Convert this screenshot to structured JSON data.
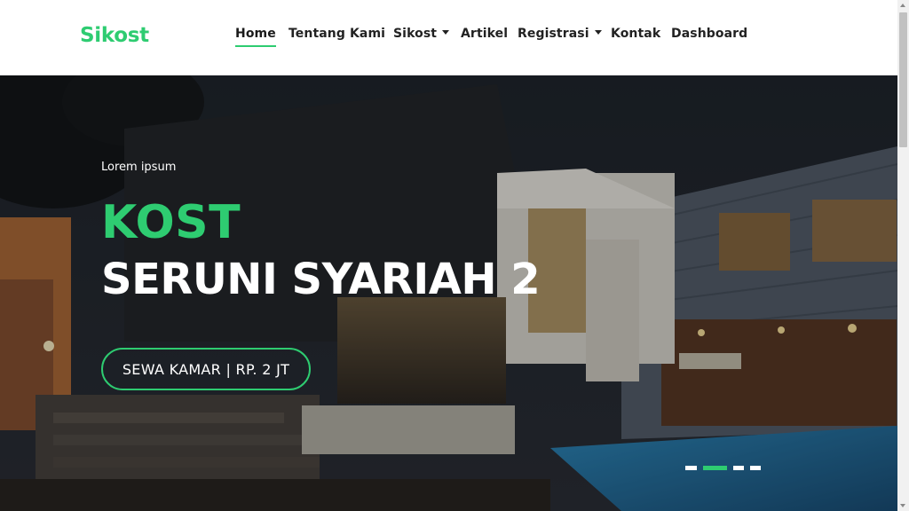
{
  "brand": {
    "name": "Sikost",
    "color": "#2ecc71"
  },
  "nav": {
    "items": [
      {
        "label": "Home",
        "active": true,
        "dropdown": false
      },
      {
        "label": "Tentang Kami",
        "active": false,
        "dropdown": false
      },
      {
        "label": "Sikost",
        "active": false,
        "dropdown": true
      },
      {
        "label": "Artikel",
        "active": false,
        "dropdown": false
      },
      {
        "label": "Registrasi",
        "active": false,
        "dropdown": true
      },
      {
        "label": "Kontak",
        "active": false,
        "dropdown": false
      },
      {
        "label": "Dashboard",
        "active": false,
        "dropdown": false
      }
    ]
  },
  "hero": {
    "eyebrow": "Lorem ipsum",
    "title_line1": "KOST",
    "title_line2": "SERUNI SYARIAH 2",
    "cta_label": "SEWA KAMAR | RP. 2 JT",
    "slides": {
      "count": 4,
      "active_index": 1
    }
  },
  "colors": {
    "accent": "#2ecc71",
    "text_dark": "#222222",
    "hero_text": "#ffffff"
  }
}
